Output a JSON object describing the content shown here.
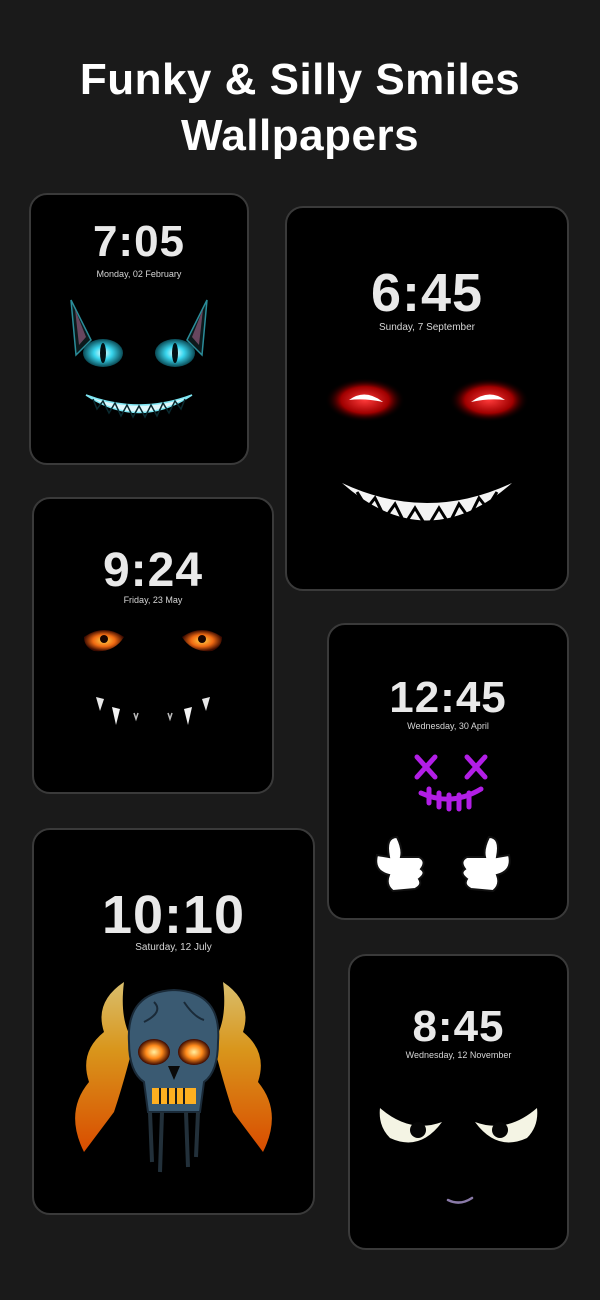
{
  "header": {
    "title_line1": "Funky & Silly Smiles",
    "title_line2": "Wallpapers"
  },
  "wallpapers": [
    {
      "time": "7:05",
      "date": "Monday, 02 February",
      "art": "cat-face-icon",
      "accent": "#33d1e8"
    },
    {
      "time": "6:45",
      "date": "Sunday, 7 September",
      "art": "red-eyed-grin-icon",
      "accent": "#e01a1a"
    },
    {
      "time": "9:24",
      "date": "Friday, 23 May",
      "art": "orange-eyed-fangs-icon",
      "accent": "#f07a1a"
    },
    {
      "time": "12:45",
      "date": "Wednesday, 30 April",
      "art": "purple-x-eyes-thumbs-up-icon",
      "accent": "#b21ee6"
    },
    {
      "time": "10:10",
      "date": "Saturday, 12 July",
      "art": "flaming-skull-icon",
      "accent": "#ff7a1a"
    },
    {
      "time": "8:45",
      "date": "Wednesday, 12 November",
      "art": "grumpy-eyes-icon",
      "accent": "#f0f0d0"
    }
  ]
}
